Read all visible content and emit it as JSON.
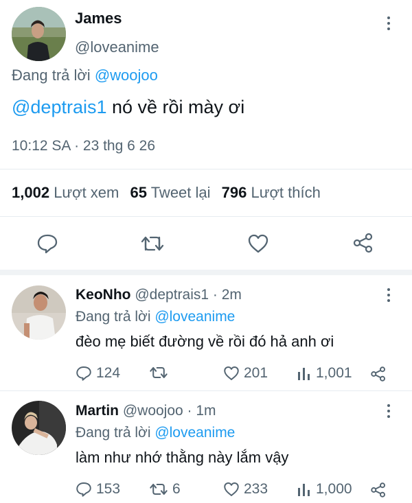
{
  "main_tweet": {
    "display_name": "James",
    "handle": "@loveanime",
    "replying_prefix": "Đang trả lời",
    "replying_to": "@woojoo",
    "mention": "@deptrais1",
    "text": " nó về rồi mày ơi",
    "timestamp": "10:12 SA · 23 thg 6 26",
    "stats": {
      "views_count": "1,002",
      "views_label": "Lượt xem",
      "retweets_count": "65",
      "retweets_label": "Tweet lại",
      "likes_count": "796",
      "likes_label": "Lượt thích"
    }
  },
  "replies": [
    {
      "display_name": "KeoNho",
      "handle_time": "@deptrais1 · 2m",
      "replying_prefix": "Đang trả lời",
      "replying_to": "@loveanime",
      "text": "đèo mẹ biết đường về rồi đó hả anh ơi",
      "reply_count": "124",
      "retweet_count": "",
      "like_count": "201",
      "view_count": "1,001"
    },
    {
      "display_name": "Martin",
      "handle_time": "@woojoo · 1m",
      "replying_prefix": "Đang trả lời",
      "replying_to": "@loveanime",
      "text": "làm như nhớ thằng này lắm vậy",
      "reply_count": "153",
      "retweet_count": "6",
      "like_count": "233",
      "view_count": "1,000"
    }
  ],
  "icons": {
    "reply": "speech-bubble-icon",
    "retweet": "retweet-arrows-icon",
    "like": "heart-outline-icon",
    "share": "share-nodes-icon",
    "views": "bar-chart-icon",
    "more": "vertical-dots-icon"
  },
  "colors": {
    "accent": "#1d9bf0",
    "secondary_text": "#536471",
    "divider": "#e6ecf0"
  }
}
